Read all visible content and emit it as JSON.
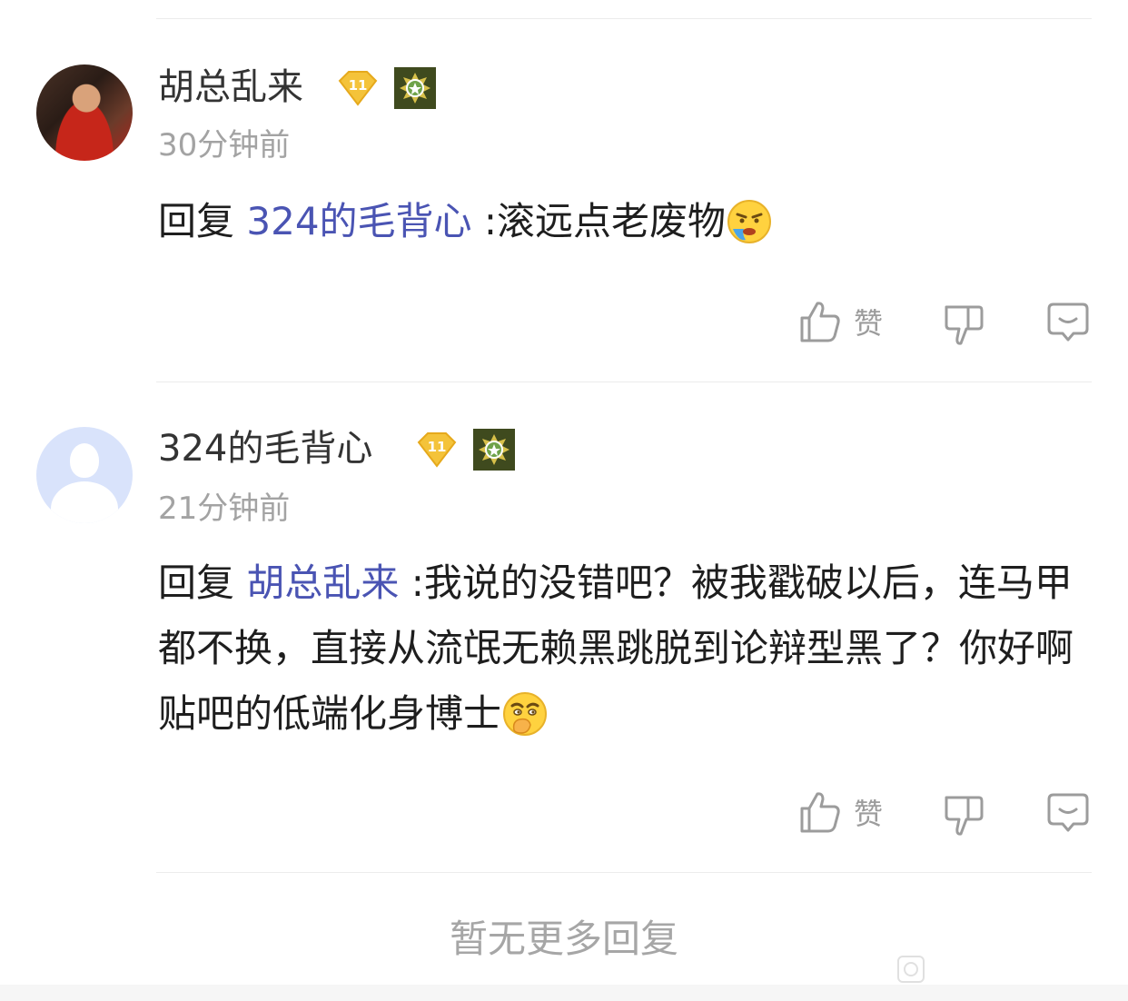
{
  "comments": [
    {
      "username": "胡总乱来",
      "level": "11",
      "time": "30分钟前",
      "reply_prefix": "回复",
      "reply_to": "324的毛背心",
      "text": ":滚远点老废物",
      "emoji": "vomit-face-emoji",
      "like_label": "赞"
    },
    {
      "username": "324的毛背心",
      "level": "11",
      "time": "21分钟前",
      "reply_prefix": "回复",
      "reply_to": "胡总乱来",
      "text": ":我说的没错吧？被我戳破以后，连马甲都不换，直接从流氓无赖黑跳脱到论辩型黑了？你好啊贴吧的低端化身博士",
      "emoji": "smirk-cover-mouth-emoji",
      "like_label": "赞"
    }
  ],
  "footer": {
    "no_more_replies": "暂无更多回复"
  },
  "colors": {
    "mention": "#4a54b3",
    "level_badge": "#f4c33a",
    "medal": "#3f4a1e"
  }
}
